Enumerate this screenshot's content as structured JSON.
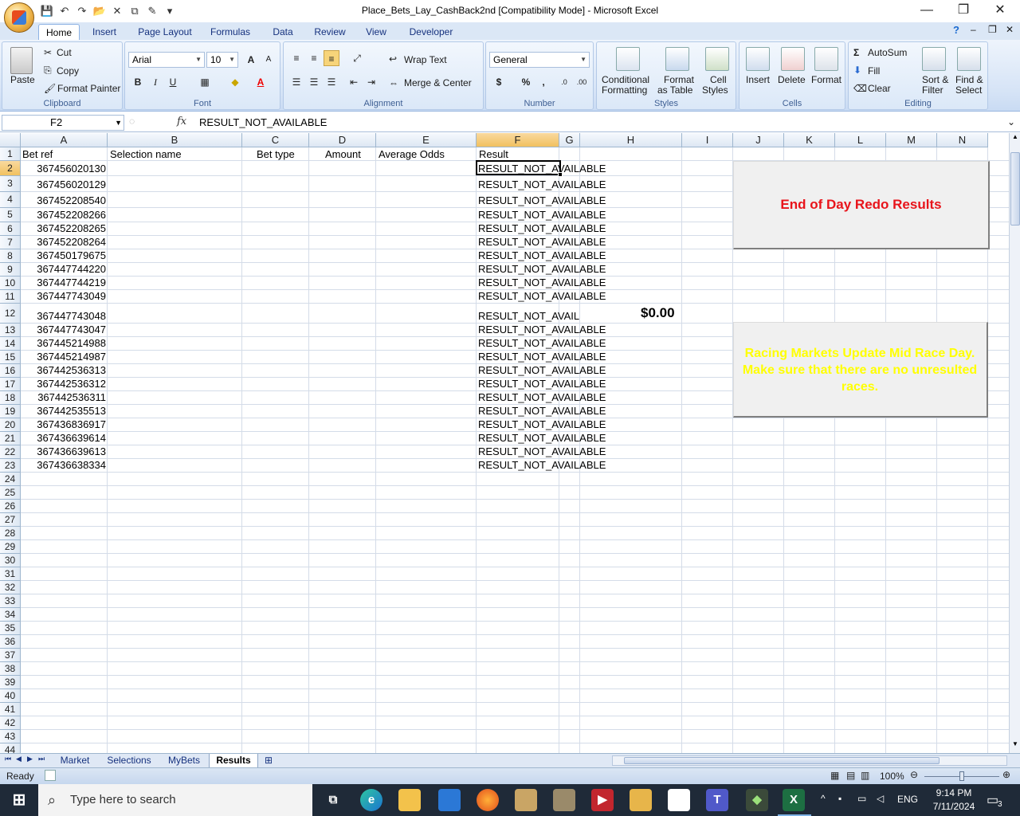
{
  "window": {
    "title": "Place_Bets_Lay_CashBack2nd  [Compatibility Mode] - Microsoft Excel",
    "minimize": "—",
    "restore": "❐",
    "close": "✕"
  },
  "ribbon_tabs": [
    "Home",
    "Insert",
    "Page Layout",
    "Formulas",
    "Data",
    "Review",
    "View",
    "Developer"
  ],
  "clipboard": {
    "paste": "Paste",
    "cut": "Cut",
    "copy": "Copy",
    "format_painter": "Format Painter",
    "label": "Clipboard"
  },
  "font": {
    "name": "Arial",
    "size": "10",
    "label": "Font",
    "bold": "B",
    "italic": "I",
    "underline": "U"
  },
  "alignment": {
    "wrap_text": "Wrap Text",
    "merge_center": "Merge & Center",
    "label": "Alignment"
  },
  "number": {
    "format": "General",
    "currency": "$",
    "percent": "%",
    "comma": ",",
    "label": "Number"
  },
  "styles": {
    "conditional": "Conditional",
    "formatting": "Formatting",
    "format_as": "Format",
    "as_table": "as Table",
    "cell": "Cell",
    "cell_styles": "Styles",
    "label": "Styles"
  },
  "cells": {
    "insert": "Insert",
    "delete": "Delete",
    "format": "Format",
    "label": "Cells"
  },
  "editing": {
    "autosum": "AutoSum",
    "fill": "Fill",
    "clear": "Clear",
    "sort": "Sort &",
    "filter": "Filter",
    "find": "Find &",
    "select": "Select",
    "label": "Editing"
  },
  "formula_bar": {
    "name_box": "F2",
    "fx": "fx",
    "value": "RESULT_NOT_AVAILABLE"
  },
  "columns": [
    "A",
    "B",
    "C",
    "D",
    "E",
    "F",
    "G",
    "H",
    "I",
    "J",
    "K",
    "L",
    "M",
    "N"
  ],
  "headers": {
    "a": "Bet ref",
    "b": "Selection name",
    "c": "Bet type",
    "d": "Amount",
    "e": "Average Odds",
    "f": "Result"
  },
  "rows": [
    {
      "ref": "367456020130",
      "result": "RESULT_NOT_AVAILABLE"
    },
    {
      "ref": "367456020129",
      "result": "RESULT_NOT_AVAILABLE"
    },
    {
      "ref": "367452208540",
      "result": "RESULT_NOT_AVAILABLE"
    },
    {
      "ref": "367452208266",
      "result": "RESULT_NOT_AVAILABLE"
    },
    {
      "ref": "367452208265",
      "result": "RESULT_NOT_AVAILABLE"
    },
    {
      "ref": "367452208264",
      "result": "RESULT_NOT_AVAILABLE"
    },
    {
      "ref": "367450179675",
      "result": "RESULT_NOT_AVAILABLE"
    },
    {
      "ref": "367447744220",
      "result": "RESULT_NOT_AVAILABLE"
    },
    {
      "ref": "367447744219",
      "result": "RESULT_NOT_AVAILABLE"
    },
    {
      "ref": "367447743049",
      "result": "RESULT_NOT_AVAILABLE"
    },
    {
      "ref": "367447743048",
      "result": "RESULT_NOT_AVAIL"
    },
    {
      "ref": "367447743047",
      "result": "RESULT_NOT_AVAILABLE"
    },
    {
      "ref": "367445214988",
      "result": "RESULT_NOT_AVAILABLE"
    },
    {
      "ref": "367445214987",
      "result": "RESULT_NOT_AVAILABLE"
    },
    {
      "ref": "367442536313",
      "result": "RESULT_NOT_AVAILABLE"
    },
    {
      "ref": "367442536312",
      "result": "RESULT_NOT_AVAILABLE"
    },
    {
      "ref": "367442536311",
      "result": "RESULT_NOT_AVAILABLE"
    },
    {
      "ref": "367442535513",
      "result": "RESULT_NOT_AVAILABLE"
    },
    {
      "ref": "367436836917",
      "result": "RESULT_NOT_AVAILABLE"
    },
    {
      "ref": "367436639614",
      "result": "RESULT_NOT_AVAILABLE"
    },
    {
      "ref": "367436639613",
      "result": "RESULT_NOT_AVAILABLE"
    },
    {
      "ref": "367436638334",
      "result": "RESULT_NOT_AVAILABLE"
    }
  ],
  "row_numbers": [
    "1",
    "2",
    "3",
    "4",
    "5",
    "6",
    "7",
    "8",
    "9",
    "10",
    "11",
    "12",
    "13",
    "14",
    "15",
    "16",
    "17",
    "18",
    "19",
    "20",
    "21",
    "22",
    "23",
    "24",
    "25",
    "26",
    "27",
    "28",
    "29",
    "30",
    "31",
    "32",
    "33",
    "34",
    "35",
    "36",
    "37",
    "38",
    "39",
    "40",
    "41",
    "42",
    "43",
    "44"
  ],
  "h12_value": "$0.00",
  "buttons": {
    "end_of_day": "End of Day Redo Results",
    "racing_update": "Racing Markets Update Mid Race Day. Make sure that there are no unresulted races."
  },
  "sheet_tabs": [
    "Market",
    "Selections",
    "MyBets",
    "Results"
  ],
  "active_sheet": "Results",
  "status": {
    "mode": "Ready",
    "zoom": "100%"
  },
  "taskbar": {
    "search_placeholder": "Type here to search",
    "lang": "ENG",
    "time": "9:14 PM",
    "date": "7/11/2024",
    "notifications": "3"
  },
  "colors": {
    "end_of_day_text": "#e8141b",
    "racing_update_text": "#ffff00",
    "active_tab_accent": "#f1c15f"
  }
}
